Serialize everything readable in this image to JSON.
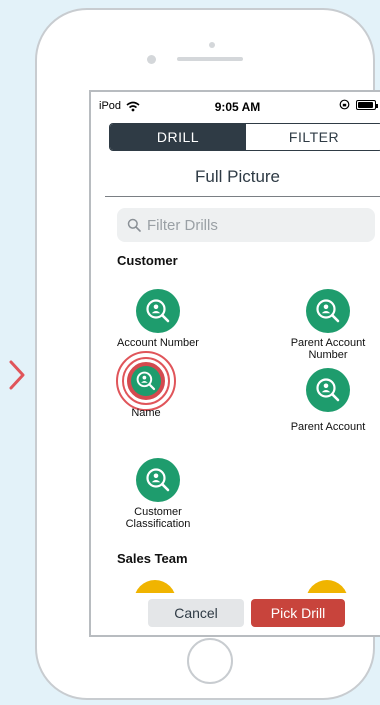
{
  "status_bar": {
    "carrier": "iPod",
    "time": "9:05 AM"
  },
  "segmented_control": {
    "tabs": [
      {
        "label": "DRILL",
        "selected": true
      },
      {
        "label": "FILTER",
        "selected": false
      }
    ]
  },
  "page": {
    "title": "Full Picture"
  },
  "search": {
    "placeholder": "Filter Drills",
    "value": ""
  },
  "sections": [
    {
      "title": "Customer",
      "drills": [
        {
          "label": "Account Number"
        },
        {
          "label": "Parent Account Number"
        },
        {
          "label": "Name",
          "highlighted": true
        },
        {
          "label": "Parent Account"
        },
        {
          "label": "Customer Classification"
        }
      ]
    },
    {
      "title": "Sales Team",
      "drills": []
    }
  ],
  "footer": {
    "cancel_label": "Cancel",
    "pick_label": "Pick Drill"
  },
  "colors": {
    "drill_icon": "#1e9c6d",
    "highlight": "#e0555a",
    "primary_button": "#c8443c",
    "segment_active": "#2f3b45",
    "sales_team_icon": "#f0b400",
    "background": "#e3f2f9"
  },
  "icons": {
    "drill": "person-search-icon",
    "search": "magnifier-icon",
    "side_arrow": "chevron-right-icon"
  }
}
